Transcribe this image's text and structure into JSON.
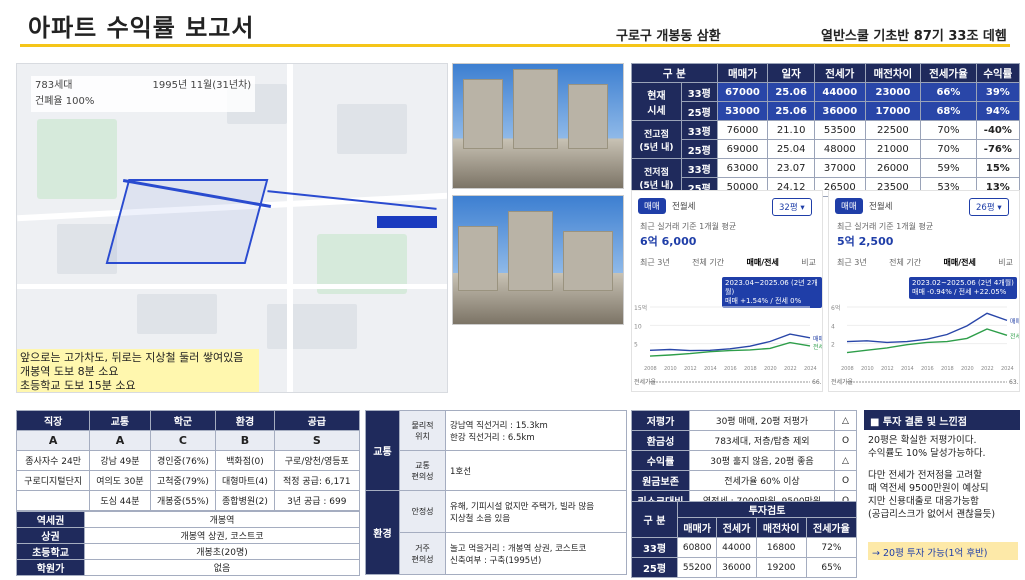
{
  "header": {
    "title": "아파트 수익률 보고서",
    "location": "구로구 개봉동 삼환",
    "author": "열반스쿨 기초반 87기 33조 데헴"
  },
  "map": {
    "households": "783세대",
    "built": "1995년 11월(31년차)",
    "occupancy": "건폐율 100%",
    "notes": [
      "앞으로는 고가차도, 뒤로는 지상철 둘러 쌓여있음",
      "개봉역 도보 8분 소요",
      "초등학교 도보 15분 소요"
    ]
  },
  "colors": {
    "navy": "#1f2a5c",
    "blue": "#2946a8",
    "yellow": "#f5c518"
  },
  "price_table": {
    "headers": [
      "구 분",
      "",
      "매매가",
      "일자",
      "전세가",
      "매전차이",
      "전세가율",
      "수익률"
    ],
    "groups": [
      {
        "label": "현재\n시세",
        "rows": [
          [
            "33평",
            "67000",
            "25.06",
            "44000",
            "23000",
            "66%",
            "39%"
          ],
          [
            "25평",
            "53000",
            "25.06",
            "36000",
            "17000",
            "68%",
            "94%"
          ]
        ]
      },
      {
        "label": "전고점\n(5년 내)",
        "rows": [
          [
            "33평",
            "76000",
            "21.10",
            "53500",
            "22500",
            "70%",
            "-40%"
          ],
          [
            "25평",
            "69000",
            "25.04",
            "48000",
            "21000",
            "70%",
            "-76%"
          ]
        ]
      },
      {
        "label": "전저점\n(5년 내)",
        "rows": [
          [
            "33평",
            "63000",
            "23.07",
            "37000",
            "26000",
            "59%",
            "15%"
          ],
          [
            "25평",
            "50000",
            "24.12",
            "26500",
            "23500",
            "53%",
            "13%"
          ]
        ]
      }
    ]
  },
  "charts": [
    {
      "tab_sale": "매매",
      "tab_jeonse": "전월세",
      "size": "32평",
      "recent": "최근 실거래 기준 1개월 평균",
      "price": "6억 6,000",
      "periods": [
        "최근 3년",
        "전체 기간",
        "매매/전세",
        "비교"
      ],
      "tooltip1": "2023.04~2025.06 (2년 2개월)",
      "tooltip2": "매매 +1.54% / 전세 0%",
      "yticks": [
        "15억",
        "10",
        "5"
      ],
      "xticks": [
        "2008",
        "2010",
        "2012",
        "2014",
        "2016",
        "2018",
        "2020",
        "2022",
        "2024"
      ],
      "sale_label": "매매",
      "jeonse_label": "전세",
      "bottom_label": "전세가율",
      "bottom_value": "66.1%",
      "chart_data": {
        "type": "line",
        "x": [
          2008,
          2010,
          2012,
          2014,
          2016,
          2018,
          2020,
          2022,
          2024
        ],
        "series": [
          {
            "name": "매매",
            "values": [
              3.2,
              3.4,
              3.1,
              3.2,
              3.6,
              4.3,
              5.6,
              7.6,
              6.6
            ]
          },
          {
            "name": "전세",
            "values": [
              1.6,
              1.9,
              2.3,
              2.8,
              3.1,
              3.3,
              3.7,
              5.3,
              4.4
            ]
          }
        ],
        "ylim": [
          0,
          15
        ]
      }
    },
    {
      "tab_sale": "매매",
      "tab_jeonse": "전월세",
      "size": "26평",
      "recent": "최근 실거래 기준 1개월 평균",
      "price": "5억 2,500",
      "periods": [
        "최근 3년",
        "전체 기간",
        "매매/전세",
        "비교"
      ],
      "tooltip1": "2023.02~2025.06 (2년 4개월)",
      "tooltip2": "매매 -0.94% / 전세 +22.05%",
      "yticks": [
        "6억",
        "4",
        "2"
      ],
      "xticks": [
        "2008",
        "2010",
        "2012",
        "2014",
        "2016",
        "2018",
        "2020",
        "2022",
        "2024"
      ],
      "sale_label": "매매",
      "jeonse_label": "전세",
      "bottom_label": "전세가율",
      "bottom_value": "63.3%",
      "chart_data": {
        "type": "line",
        "x": [
          2008,
          2010,
          2012,
          2014,
          2016,
          2018,
          2020,
          2022,
          2024
        ],
        "series": [
          {
            "name": "매매",
            "values": [
              2.6,
              2.7,
              2.5,
              2.6,
              2.9,
              3.5,
              4.6,
              6.2,
              5.3
            ]
          },
          {
            "name": "전세",
            "values": [
              1.2,
              1.5,
              1.8,
              2.2,
              2.5,
              2.6,
              3.0,
              4.2,
              3.4
            ]
          }
        ],
        "ylim": [
          0,
          7
        ]
      }
    }
  ],
  "score_table": {
    "headers": [
      "직장",
      "교통",
      "학군",
      "환경",
      "공급"
    ],
    "grades": [
      "A",
      "A",
      "C",
      "B",
      "S"
    ],
    "rows": [
      [
        "종사자수 24만",
        "강남 49분",
        "경인중(76%)",
        "백화점(0)",
        "구로/양천/영등포"
      ],
      [
        "구로디지털단지",
        "여의도 30분",
        "고척중(79%)",
        "대형마트(4)",
        "적정 공급: 6,171"
      ],
      [
        "",
        "도심 44분",
        "개봉중(55%)",
        "종합병원(2)",
        "3년 공급 : 699"
      ]
    ]
  },
  "info_table": [
    [
      "역세권",
      "개봉역"
    ],
    [
      "상권",
      "개봉역 상권, 코스트코"
    ],
    [
      "초등학교",
      "개봉초(20명)"
    ],
    [
      "학원가",
      "없음"
    ]
  ],
  "traffic": {
    "label1": "교통",
    "label2": "환경",
    "rows": [
      [
        "물리적\n위치",
        "강남역 직선거리 : 15.3km\n한강 직선거리 : 6.5km"
      ],
      [
        "교통\n편의성",
        "1호선"
      ],
      [
        "안정성",
        "유해, 기피시설 없지만 주택가, 빌라 많음\n지상철 소음 있음"
      ],
      [
        "거주\n편의성",
        "놀고 먹을거리 : 개봉역 상권, 코스트코\n신축여부 : 구축(1995년)"
      ]
    ]
  },
  "criteria": [
    [
      "저평가",
      "30평 매매, 20평 저평가",
      "△"
    ],
    [
      "환금성",
      "783세대, 저층/탑층 제외",
      "O"
    ],
    [
      "수익률",
      "30평 훌지 않음, 20평 좋음",
      "△"
    ],
    [
      "원금보존",
      "전세가율 60% 이상",
      "O"
    ],
    [
      "리스크대비",
      "역전세 : 7000만원, 9500만원",
      "O"
    ]
  ],
  "invest": {
    "title": "투자검토",
    "label": "구 분",
    "headers": [
      "매매가",
      "전세가",
      "매전차이",
      "전세가율"
    ],
    "rows": [
      [
        "33평",
        "60800",
        "44000",
        "16800",
        "72%"
      ],
      [
        "25평",
        "55200",
        "36000",
        "19200",
        "65%"
      ]
    ]
  },
  "conclusion": {
    "title": "■ 투자 결론 및 느낀점",
    "lines": [
      "20평은 확실한 저평가이다.",
      "수익률도 10% 달성가능하다.",
      "",
      "다만 전세가 전저점을 고려할",
      "때 역전세 9500만원이 예상되",
      "지만 신용대출로 대응가능함",
      "(공급리스크가 없어서 괜찮을듯)"
    ],
    "result": "→ 20평 투자 가능(1억 후반)"
  }
}
